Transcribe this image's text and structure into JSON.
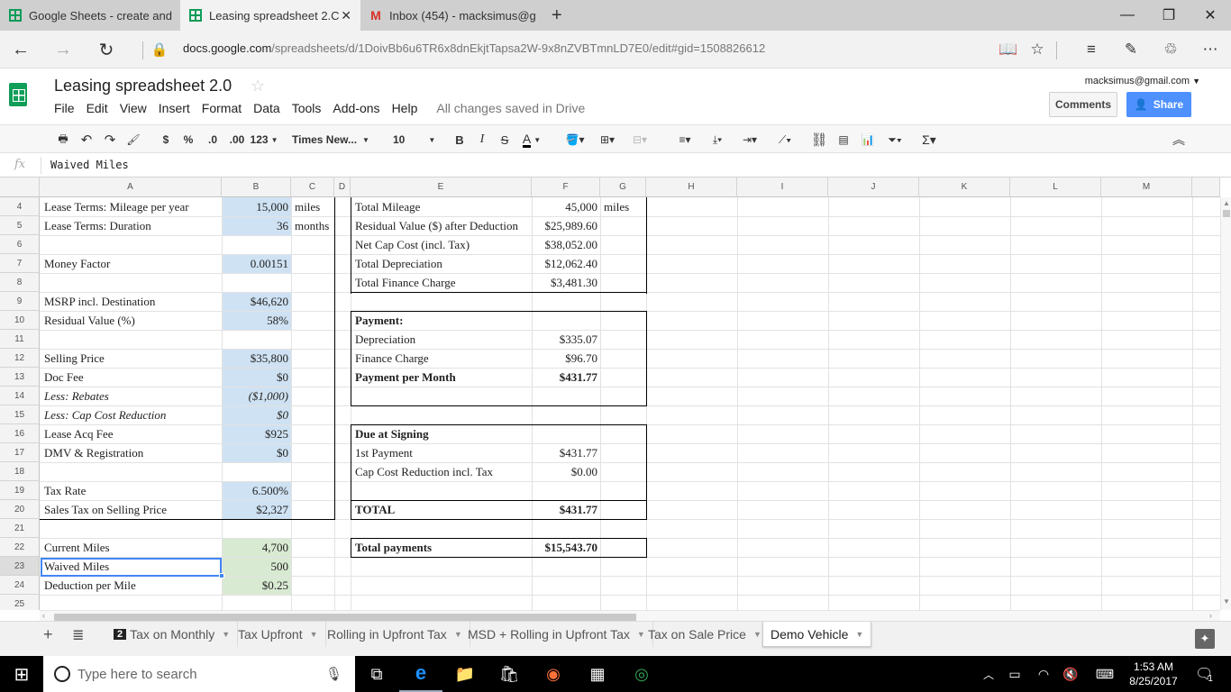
{
  "browser": {
    "tabs": [
      {
        "label": "Google Sheets - create and"
      },
      {
        "label": "Leasing spreadsheet 2.C"
      },
      {
        "label": "Inbox (454) - macksimus@g"
      }
    ],
    "url_domain": "docs.google.com",
    "url_path": "/spreadsheets/d/1DoivBb6u6TR6x8dnEkjtTapsa2W-9x8nZVBTmnLD7E0/edit#gid=1508826612"
  },
  "sheets": {
    "title": "Leasing spreadsheet 2.0",
    "menu": [
      "File",
      "Edit",
      "View",
      "Insert",
      "Format",
      "Data",
      "Tools",
      "Add-ons",
      "Help"
    ],
    "save_status": "All changes saved in Drive",
    "account": "macksimus@gmail.com",
    "comments_label": "Comments",
    "share_label": "Share"
  },
  "toolbar": {
    "currency": "$",
    "percent": "%",
    "dec_less": ".0",
    "dec_more": ".00",
    "format_more": "123",
    "font": "Times New...",
    "font_size": "10",
    "bold": "B",
    "italic": "I",
    "strike": "S",
    "textcolor": "A"
  },
  "formula_bar": {
    "fx": "fx",
    "value": "Waived Miles"
  },
  "columns": [
    "A",
    "B",
    "C",
    "D",
    "E",
    "F",
    "G",
    "H",
    "I",
    "J",
    "K",
    "L",
    "M"
  ],
  "rows": [
    "4",
    "5",
    "6",
    "7",
    "8",
    "9",
    "10",
    "11",
    "12",
    "13",
    "14",
    "15",
    "16",
    "17",
    "18",
    "19",
    "20",
    "21",
    "22",
    "23",
    "24",
    "25"
  ],
  "cells": {
    "A4": "Lease Terms: Mileage per year",
    "B4": "15,000",
    "C4": "miles",
    "A5": "Lease Terms: Duration",
    "B5": "36",
    "C5": "months",
    "A7": "Money Factor",
    "B7": "0.00151",
    "A9": "MSRP incl. Destination",
    "B9": "$46,620",
    "A10": "Residual Value (%)",
    "B10": "58%",
    "A12": "Selling Price",
    "B12": "$35,800",
    "A13": "Doc Fee",
    "B13": "$0",
    "A14": "Less: Rebates",
    "B14": "($1,000)",
    "A15": "Less: Cap Cost Reduction",
    "B15": "$0",
    "A16": "Lease Acq Fee",
    "B16": "$925",
    "A17": "DMV & Registration",
    "B17": "$0",
    "A19": "Tax Rate",
    "B19": "6.500%",
    "A20": "Sales Tax on Selling Price",
    "B20": "$2,327",
    "A22": "Current Miles",
    "B22": "4,700",
    "A23": "Waived Miles",
    "B23": "500",
    "A24": "Deduction per Mile",
    "B24": "$0.25",
    "E4": "Total Mileage",
    "F4": "45,000",
    "G4": "miles",
    "E5": "Residual Value ($) after Deduction",
    "F5": "$25,989.60",
    "E6": "Net Cap Cost (incl. Tax)",
    "F6": "$38,052.00",
    "E7": "Total Depreciation",
    "F7": "$12,062.40",
    "E8": "Total Finance Charge",
    "F8": "$3,481.30",
    "E10": "Payment:",
    "E11": "Depreciation",
    "F11": "$335.07",
    "E12": "Finance Charge",
    "F12": "$96.70",
    "E13": "Payment per Month",
    "F13": "$431.77",
    "E16": "Due at Signing",
    "E17": "1st Payment",
    "F17": "$431.77",
    "E18": "Cap Cost Reduction incl. Tax",
    "F18": "$0.00",
    "E20": "TOTAL",
    "F20": "$431.77",
    "E22": "Total payments",
    "F22": "$15,543.70"
  },
  "sheet_tabs": {
    "badge": "2",
    "tabs": [
      "Tax on Monthly",
      "Tax Upfront",
      "Rolling in Upfront Tax",
      "MSD + Rolling in Upfront Tax",
      "Tax on Sale Price",
      "Demo Vehicle"
    ],
    "active": "Demo Vehicle"
  },
  "taskbar": {
    "search_placeholder": "Type here to search",
    "time": "1:53 AM",
    "date": "8/25/2017",
    "notifications": "1"
  },
  "colors": {
    "input_fill": "#cfe2f3",
    "mileage_fill": "#d9ead3",
    "share_blue": "#4d90fe",
    "sheets_green": "#0f9d58"
  }
}
